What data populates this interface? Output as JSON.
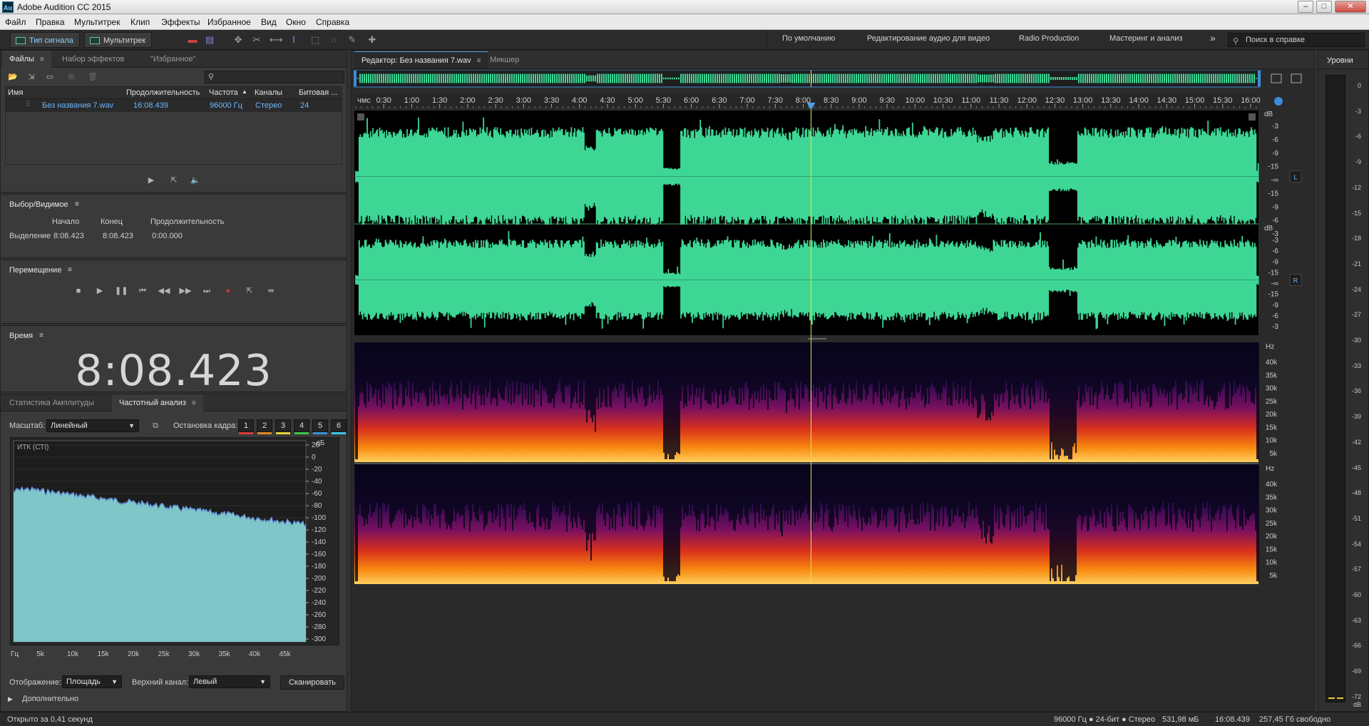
{
  "window": {
    "app_icon": "Au",
    "title": "Adobe Audition CC 2015",
    "btn_min": "–",
    "btn_max": "□",
    "btn_close": "✕"
  },
  "menu": [
    "Файл",
    "Правка",
    "Мультитрек",
    "Клип",
    "Эффекты",
    "Избранное",
    "Вид",
    "Окно",
    "Справка"
  ],
  "toolbar": {
    "mode_waveform": "Тип сигнала",
    "mode_multitrack": "Мультитрек",
    "workspaces": [
      "По умолчанию",
      "Редактирование аудио для видео",
      "Radio Production",
      "Мастеринг и анализ"
    ],
    "more": "»",
    "search_placeholder": "Поиск в справке"
  },
  "files_panel": {
    "tabs": [
      "Файлы",
      "Набор эффектов",
      "\"Избранное\""
    ],
    "menu_glyph": "≡",
    "search_glyph": "⚲",
    "columns": [
      "Имя",
      "Продолжительность",
      "Частота",
      "Каналы",
      "Битовая ..."
    ],
    "sort_glyph": "▲",
    "files": [
      {
        "name": "Без названия 7.wav",
        "duration": "16:08.439",
        "rate": "96000 Гц",
        "channels": "Стерео",
        "bits": "24"
      }
    ]
  },
  "selection_panel": {
    "title": "Выбор/Видимое",
    "col_start": "Начало",
    "col_end": "Конец",
    "col_duration": "Продолжительность",
    "row_label": "Выделение",
    "start": "8:08.423",
    "end": "8:08.423",
    "duration": "0:00.000"
  },
  "transport_panel": {
    "title": "Перемещение"
  },
  "time_panel": {
    "title": "Время",
    "value": "8:08.423"
  },
  "analysis_panel": {
    "tabs": [
      "Статистика Амплитуды",
      "Частотный анализ"
    ],
    "scale_label": "Масштаб:",
    "scale_value": "Линейный",
    "freeze_label": "Остановка кадра:",
    "freeze_buttons": [
      "1",
      "2",
      "3",
      "4",
      "5",
      "6"
    ],
    "freeze_colors": [
      "#d93a3a",
      "#e08a2a",
      "#e3d23a",
      "#3fc84a",
      "#3f8fd8",
      "#3fc8e8"
    ],
    "graph_label": "ИТК (СТI)",
    "db_unit": "дБ",
    "db_ticks": [
      "20",
      "0",
      "-20",
      "-40",
      "-60",
      "-80",
      "-100",
      "-120",
      "-140",
      "-160",
      "-180",
      "-200",
      "-220",
      "-240",
      "-260",
      "-280",
      "-300"
    ],
    "freq_ticks": [
      "Гц",
      "5k",
      "10k",
      "15k",
      "20k",
      "25k",
      "30k",
      "35k",
      "40k",
      "45k"
    ],
    "display_label": "Отображение:",
    "display_value": "Площадь",
    "channel_label": "Верхний канал:",
    "channel_value": "Левый",
    "scan_label": "Сканировать",
    "advanced_label": "Дополнительно"
  },
  "editor": {
    "tabs": [
      "Редактор: Без названия 7.wav",
      "Микшер"
    ],
    "ruler_unit": "чмс",
    "ruler_labels": [
      "0:30",
      "1:00",
      "1:30",
      "2:00",
      "2:30",
      "3:00",
      "3:30",
      "4:00",
      "4:30",
      "5:00",
      "5:30",
      "6:00",
      "6:30",
      "7:00",
      "7:30",
      "8:00",
      "8:30",
      "9:00",
      "9:30",
      "10:00",
      "10:30",
      "11:00",
      "11:30",
      "12:00",
      "12:30",
      "13:00",
      "13:30",
      "14:00",
      "14:30",
      "15:00",
      "15:30",
      "16:00"
    ],
    "playhead_time": "8:08.423",
    "total_time": "16:08.439",
    "channel_L": "L",
    "channel_R": "R",
    "db_unit": "dB",
    "db_labels": [
      "-3",
      "-6",
      "-9",
      "-15",
      "-∞",
      "-15",
      "-9",
      "-6",
      "-3"
    ],
    "hz_unit": "Hz",
    "hz_labels": [
      "40k",
      "35k",
      "30k",
      "25k",
      "20k",
      "15k",
      "10k",
      "5k"
    ],
    "wave_color": "#3ed695"
  },
  "levels_panel": {
    "title": "Уровни",
    "labels": [
      "0",
      "-3",
      "-6",
      "-9",
      "-12",
      "-15",
      "-18",
      "-21",
      "-24",
      "-27",
      "-30",
      "-33",
      "-36",
      "-39",
      "-42",
      "-45",
      "-48",
      "-51",
      "-54",
      "-57",
      "-60",
      "-63",
      "-66",
      "-69",
      "-72"
    ],
    "unit": "dB"
  },
  "status": {
    "left": "Открыто за 0,41 секунд",
    "format": "96000 Гц ● 24-бит ● Стерео",
    "size": "531,98 мБ",
    "duration": "16:08.439",
    "free": "257,45 Гб свободно"
  }
}
